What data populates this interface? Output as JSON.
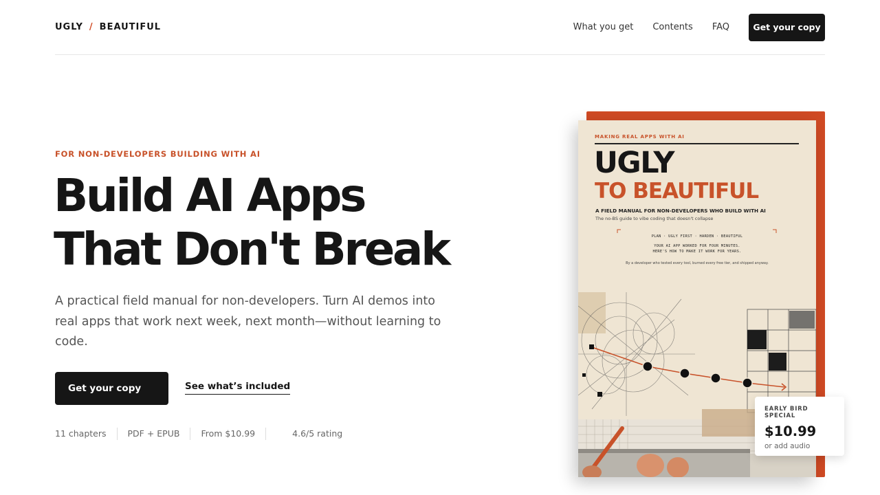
{
  "brand": {
    "first": "UGLY",
    "separator": "/",
    "second": "BEAUTIFUL"
  },
  "nav": {
    "links": [
      "What you get",
      "Contents",
      "FAQ"
    ],
    "cta": "Get your copy"
  },
  "hero": {
    "eyebrow": "FOR NON-DEVELOPERS BUILDING WITH AI",
    "headline_line1": "Build AI Apps",
    "headline_line2": "That Don't Break",
    "lead": "A practical field manual for non-developers. Turn AI demos into real apps that work next week, next month—without learning to code.",
    "primary_cta": "Get your copy",
    "secondary_cta": "See what’s included",
    "meta": [
      "11 chapters",
      "PDF + EPUB",
      "From $10.99",
      "4.6/5 rating"
    ]
  },
  "cover": {
    "kicker": "MAKING REAL APPS WITH AI",
    "title_line1": "UGLY",
    "title_line2": "TO BEAUTIFUL",
    "subtitle": "A FIELD MANUAL FOR NON-DEVELOPERS WHO BUILD WITH AI",
    "tagline": "The no-BS guide to vibe coding that doesn't collapse",
    "steps": "PLAN · UGLY FIRST · HARDEN · BEAUTIFUL",
    "line1": "YOUR AI APP WORKED FOR FOUR MINUTES.",
    "line2": "HERE'S HOW TO MAKE IT WORK FOR YEARS.",
    "author": "By a developer who tested every tool, burned every free tier, and shipped anyway."
  },
  "offer": {
    "label": "EARLY BIRD SPECIAL",
    "price": "$10.99",
    "note": "or add audio"
  },
  "colors": {
    "accent": "#d04a24",
    "ink": "#161616",
    "paper": "#efe5d3"
  }
}
